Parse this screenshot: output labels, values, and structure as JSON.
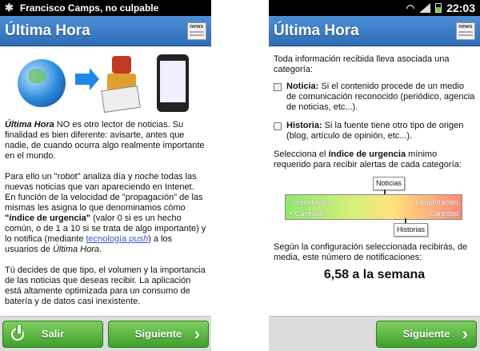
{
  "left": {
    "status_title": "Francisco Camps, no culpable",
    "app_title": "Última Hora",
    "news_icon_text": "news",
    "paragraph1": {
      "lead": "Última Hora",
      "rest": " NO es otro lector de noticias. Su finalidad es bien diferente: avisarte, antes que nadie, de cuando ocurra algo realmente importante en el mundo."
    },
    "paragraph2": {
      "p1": "Para ello un \"robot\" analiza día y noche todas las nuevas noticias que van apareciendo en Intenet. En función de la velocidad de \"propagación\" de las mismas les asigna lo que denominamos cómo ",
      "bold": "\"índice de urgencia\"",
      "p2": " (valor 0 si es un hecho común, o de 1 a 10 si se trata de algo importante) y lo notifica (mediante ",
      "link1": "tecnología ",
      "link2": "push",
      "p3": ") a los usuarios de ",
      "app": "Última Hora",
      "p4": "."
    },
    "paragraph3": "Tú decides de que tipo, el volumen y la importancia de las noticias que deseas recibir. La aplicación está altamente optimizada para un consumo de batería y de datos casi inexistente.",
    "buttons": {
      "exit": "Salir",
      "next": "Siguiente"
    }
  },
  "right": {
    "time": "22:03",
    "app_title": "Última Hora",
    "news_icon_text": "news",
    "intro": "Toda información recibida lleva asociada una categoría:",
    "noticia_label": "Noticia:",
    "noticia_text": " Si el contenido procede de un medio de comunicación reconocido (periódico, agencia de noticias, etc...).",
    "historia_label": "Historia:",
    "historia_text": " Si la fuente tiene otro tipo de origen (blog, artículo de opinión, etc...).",
    "select_p1": "Selecciona el ",
    "select_bold": "índice de urgencia",
    "select_p2": " mínimo requerido para recibir alertas de cada categoría:",
    "urgency": {
      "tag_top": "Noticias",
      "tag_bottom": "Historias",
      "left_top": "- Importantes",
      "left_bottom": "+ Cantidad",
      "right_top": "+ Importantes",
      "right_bottom": "- Cantidad"
    },
    "config_text": "Según la configuración seleccionada recibirás, de media, este número de notificaciones:",
    "result": "6,58 a la semana",
    "buttons": {
      "next": "Siguiente"
    }
  }
}
